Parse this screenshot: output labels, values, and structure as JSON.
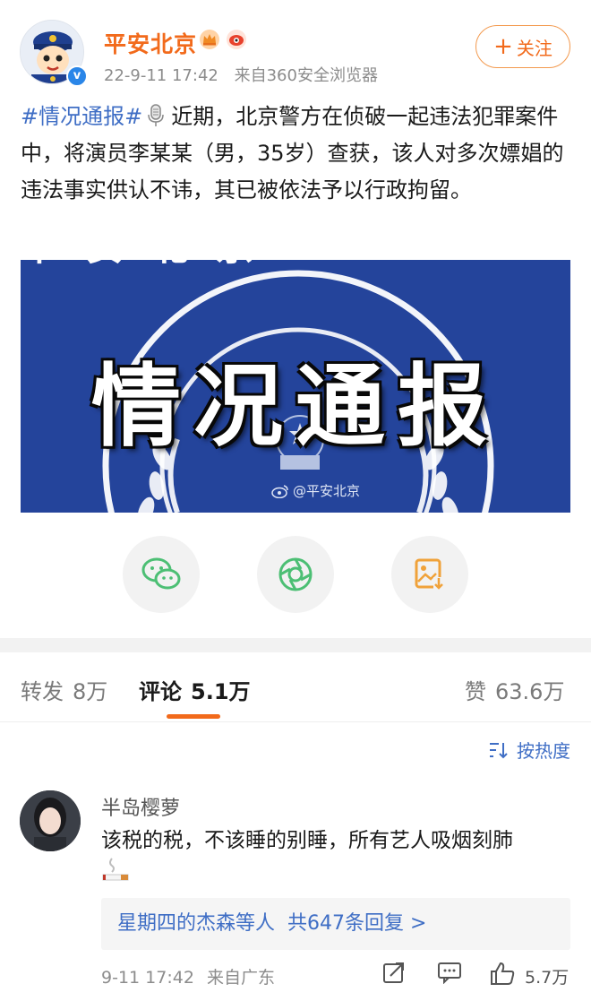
{
  "post": {
    "author": "平安北京",
    "date": "22-9-11 17:42",
    "source": "来自360安全浏览器",
    "follow_label": "关注",
    "hashtag": "#情况通报#",
    "text": "近期，北京警方在侦破一起违法犯罪案件中，将演员李某某（男，35岁）查获，该人对多次嫖娼的违法事实供认不讳，其已被依法予以行政拘留。",
    "image": {
      "arc_text": "平 安 北 京",
      "title": "情况通报",
      "watermark": "@平安北京"
    }
  },
  "share": {
    "items": [
      {
        "icon": "wechat-icon"
      },
      {
        "icon": "moments-icon"
      },
      {
        "icon": "save-image-icon"
      }
    ]
  },
  "tabs": {
    "repost": {
      "label": "转发",
      "count": "8万"
    },
    "comments": {
      "label": "评论",
      "count": "5.1万"
    },
    "likes": {
      "label": "赞",
      "count": "63.6万"
    }
  },
  "sort": {
    "label": "按热度"
  },
  "comment": {
    "username": "半岛樱萝",
    "text": "该税的税，不该睡的别睡，所有艺人吸烟刻肺",
    "replies_from": "星期四的杰森等人",
    "replies_count": "共647条回复 >",
    "date": "9-11 17:42",
    "location": "来自广东",
    "like_count": "5.7万"
  },
  "colors": {
    "accent": "#f26a1b",
    "link": "#3f6ec5",
    "banner": "#24449b",
    "wechat": "#4cbf74",
    "save": "#f0a23a"
  }
}
